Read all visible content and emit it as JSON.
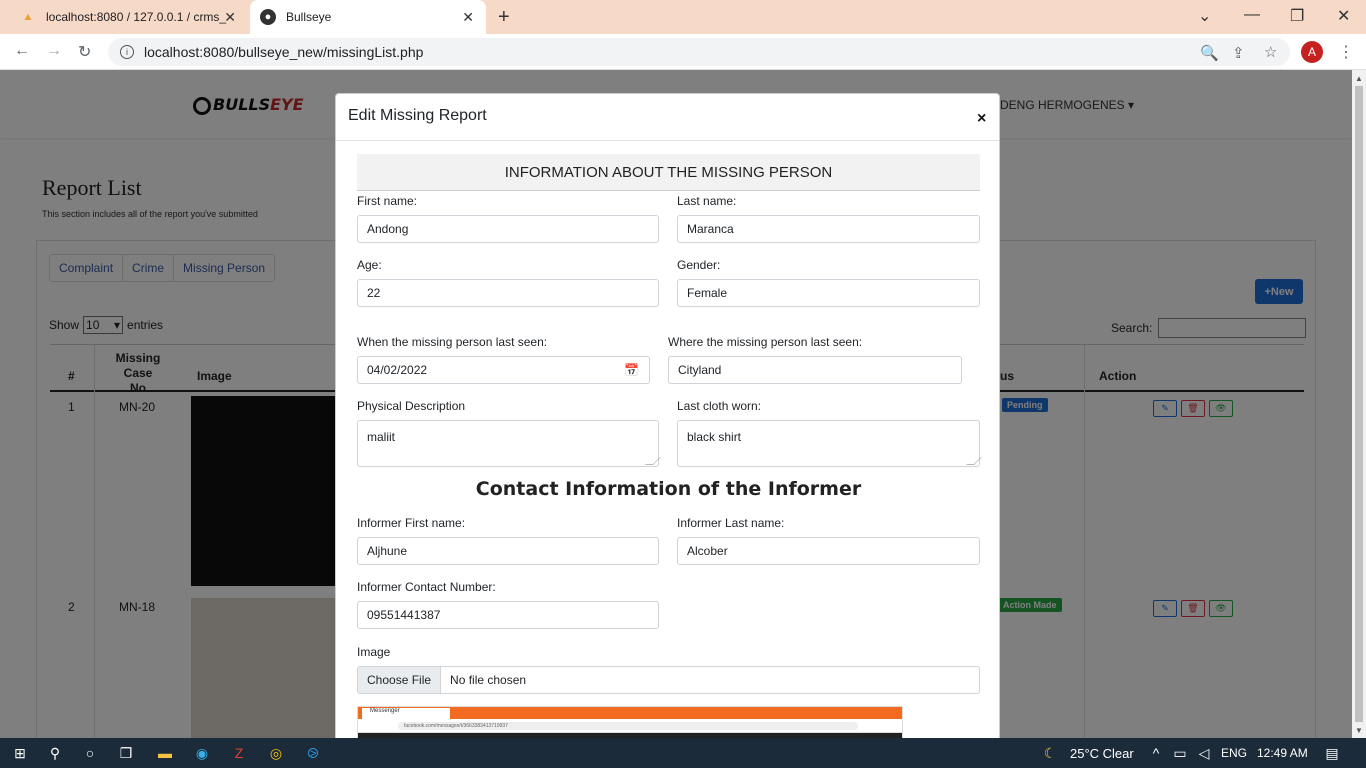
{
  "browser": {
    "tabs": [
      {
        "title": "localhost:8080 / 127.0.0.1 / crms_",
        "icon": "phpmyadmin-icon"
      },
      {
        "title": "Bullseye",
        "icon": "globe-icon"
      }
    ],
    "url": "localhost:8080/bullseye_new/missingList.php",
    "profile_initial": "A"
  },
  "site": {
    "logo_text": "BULLS",
    "logo_text_accent": "EYE",
    "user_menu": "DENG HERMOGENES"
  },
  "page": {
    "title": "Report List",
    "subtitle": "This section includes all of the report you've submitted",
    "tabs": [
      "Complaint",
      "Crime",
      "Missing Person"
    ],
    "new_button": "New",
    "show_label": "Show",
    "entries_value": "10",
    "entries_label": "entries",
    "search_label": "Search:",
    "table_headers": {
      "num": "#",
      "case_no": "Missing Case No",
      "image": "Image",
      "status": "us",
      "action": "Action"
    },
    "rows": [
      {
        "num": "1",
        "case_no": "MN-20",
        "status": "Pending",
        "status_color": "#1e6fd9"
      },
      {
        "num": "2",
        "case_no": "MN-18",
        "status": "Action Made",
        "status_color": "#28a745"
      }
    ]
  },
  "modal": {
    "title": "Edit Missing Report",
    "close_label": "×",
    "section_title": "INFORMATION ABOUT THE MISSING PERSON",
    "fields": {
      "first_name_label": "First name:",
      "first_name": "Andong",
      "last_name_label": "Last name:",
      "last_name": "Maranca",
      "age_label": "Age:",
      "age": "22",
      "gender_label": "Gender:",
      "gender": "Female",
      "last_seen_when_label": "When the missing person last seen:",
      "last_seen_when": "04/02/2022",
      "last_seen_where_label": "Where the missing person last seen:",
      "last_seen_where": "Cityland",
      "physical_label": "Physical Description",
      "physical": "maliit",
      "cloth_label": "Last cloth worn:",
      "cloth": "black shirt"
    },
    "contact_title": "Contact Information of the Informer",
    "informer": {
      "first_name_label": "Informer First name:",
      "first_name": "Aljhune",
      "last_name_label": "Informer Last name:",
      "last_name": "Alcober",
      "contact_label": "Informer Contact Number:",
      "contact": "09551441387"
    },
    "image_label": "Image",
    "choose_file": "Choose File",
    "no_file": "No file chosen",
    "preview": {
      "tab": "Messenger",
      "url": "facebook.com/messages/t/3663383413719937"
    }
  },
  "taskbar": {
    "weather": "25°C  Clear",
    "language": "ENG",
    "time": "12:49 AM"
  }
}
